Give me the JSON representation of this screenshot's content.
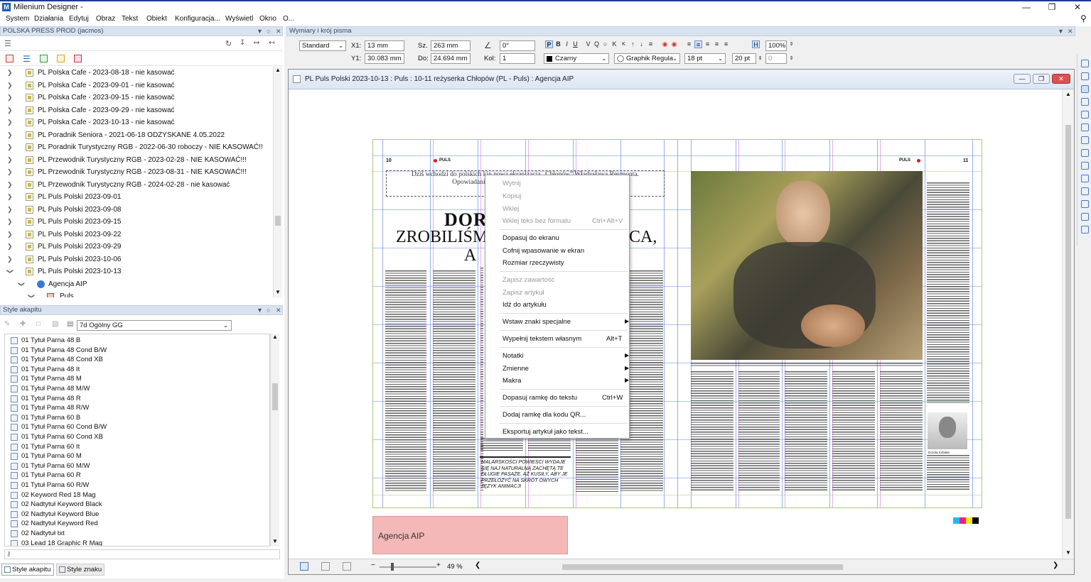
{
  "app": {
    "title": "Milenium Designer -"
  },
  "menu": [
    "System",
    "Działania",
    "Edytuj",
    "Obraz",
    "Tekst",
    "Obiekt",
    "Konfiguracja...",
    "Wyświetl",
    "Okno",
    "O..."
  ],
  "left_top": {
    "header": "POLSKA PRESS PROD (jacmos)",
    "tree": [
      "PL Polska Cafe - 2023-08-18 - nie kasować",
      "PL Polska Cafe - 2023-09-01 - nie kasować",
      "PL Polska Cafe - 2023-09-15 - nie kasować",
      "PL Polska Cafe - 2023-09-29 - nie kasować",
      "PL Polska Cafe - 2023-10-13 - nie kasować",
      "PL Poradnik Seniora - 2021-06-18 ODZYSKANE 4.05.2022",
      "PL Poradnik Turystyczny RGB - 2022-06-30 roboczy - NIE KASOWAĆ!!",
      "PL Przewodnik Turystyczny RGB - 2023-02-28 - NIE KASOWAĆ!!!",
      "PL Przewodnik Turystyczny RGB - 2023-08-31 - NIE KASOWAĆ!!!",
      "PL Przewodnik Turystyczny RGB - 2024-02-28 - nie kasować",
      "PL Puls Polski 2023-09-01",
      "PL Puls Polski 2023-09-08",
      "PL Puls Polski 2023-09-15",
      "PL Puls Polski 2023-09-22",
      "PL Puls Polski 2023-09-29",
      "PL Puls Polski 2023-10-06",
      "PL Puls Polski 2023-10-13"
    ],
    "child": "Agencja AIP",
    "grandchild": "Puls"
  },
  "left_bottom": {
    "header": "Style akapitu",
    "style_select": "7d Ogólny GG",
    "styles": [
      "01 Tytuł Parna 48 B",
      "01 Tytuł Parna 48 Cond B/W",
      "01 Tytuł Parna 48 Cond XB",
      "01 Tytuł Parna 48 It",
      "01 Tytuł Parna 48 M",
      "01 Tytuł Parna 48 M/W",
      "01 Tytuł Parna 48 R",
      "01 Tytuł Parna 48 R/W",
      "01 Tytuł Parna 60 B",
      "01 Tytuł Parna 60 Cond B/W",
      "01 Tytuł Parna 60 Cond XB",
      "01 Tytuł Parna 60 It",
      "01 Tytuł Parna 60 M",
      "01 Tytuł Parna 60 M/W",
      "01 Tytuł Parna 60 R",
      "01 Tytuł Parna 60 R/W",
      "02 Keyword Red 18 Mag",
      "02 Nadtytuł Keyword Black",
      "02 Nadtytuł Keyword Blue",
      "02 Nadtytuł Keyword Red",
      "02 Nadtytuł txt",
      "03 Lead 18 Graphic R Mag"
    ],
    "tabs": [
      "Style akapitu",
      "Style znaku"
    ]
  },
  "toolbar": {
    "header": "Wymiary i krój pisma",
    "preset": "Standard",
    "x1_label": "X1:",
    "x1": "13 mm",
    "y1_label": "Y1:",
    "y1": "30.083 mm",
    "sz_label": "Sz.",
    "sz": "263 mm",
    "do_label": "Do:",
    "do": "24.694 mm",
    "angle": "0°",
    "kol_label": "Kol:",
    "kol": "1",
    "format_buttons": [
      "P",
      "B",
      "I",
      "U",
      "V",
      "Q",
      "K",
      "K"
    ],
    "color": "Czarny",
    "font": "Graphik Regula",
    "size": "18 pt",
    "leading": "20 pt",
    "scale": "100%",
    "tracking": "0",
    "h_btn": "H"
  },
  "document": {
    "title": "PL Puls Polski 2023-10-13 : Puls : 10-11 reżyserka Chłopów (PL - Puls) : Agencja AIP",
    "zoom": "49 %",
    "agency_box": "Agencja AIP",
    "agency_color": "#f4b8b8",
    "page": {
      "logo": "PULS",
      "page_left": "10",
      "page_right": "11",
      "lead": "Dziś wchodzi do polskich kin nowa ekranizacja „Chłopów” Władysława Reymonta. Opowiadaniu tej niezwykłej… … reżyserka Dorota…",
      "headline_1": "DOR",
      "headline_2": "ZROBILIŚMY",
      "headline_3": "CA,",
      "headline_4": "A",
      "pull_quote": "MALARSKOŚCI POWIESCI WYDAJE SIĘ NAJ NATURALNĄ ZACHĘTĄ TE DŁUGIE PASAŻE. AŻ KUSIŁY, ABY JE PRZEŁOŻYĆ NA SKRÓT OWYCH JĘZYK ANIMACJI",
      "author": "Dorota Kobiela"
    }
  },
  "context_menu": [
    {
      "label": "Wytnij",
      "disabled": true
    },
    {
      "label": "Kopiuj",
      "disabled": true
    },
    {
      "label": "Wklej",
      "disabled": true
    },
    {
      "label": "Wklej teks bez formatu",
      "shortcut": "Ctrl+Alt+V",
      "disabled": true
    },
    {
      "label": "Dopasuj do ekranu"
    },
    {
      "label": "Cofnij wpasowanie w ekran"
    },
    {
      "label": "Rozmiar rzeczywisty"
    },
    {
      "label": "Zapisz zawartość",
      "disabled": true
    },
    {
      "label": "Zapisz artykuł",
      "disabled": true
    },
    {
      "label": "Idź do artykułu"
    },
    {
      "label": "Wstaw znaki specjalne",
      "submenu": true
    },
    {
      "label": "Wypełnij tekstem własnym",
      "shortcut": "Alt+T"
    },
    {
      "label": "Notatki",
      "submenu": true
    },
    {
      "label": "Zmienne",
      "submenu": true
    },
    {
      "label": "Makra",
      "submenu": true
    },
    {
      "label": "Dopasuj ramkę do tekstu",
      "shortcut": "Ctrl+W"
    },
    {
      "label": "Dodaj ramkę dla kodu QR..."
    },
    {
      "label": "Eksportuj artykuł jako tekst..."
    }
  ],
  "colors": {
    "accent": "#1f3b8f",
    "guide": "#6c8fe0",
    "page_border": "#a9c97a",
    "logo_red": "#d0202b"
  }
}
